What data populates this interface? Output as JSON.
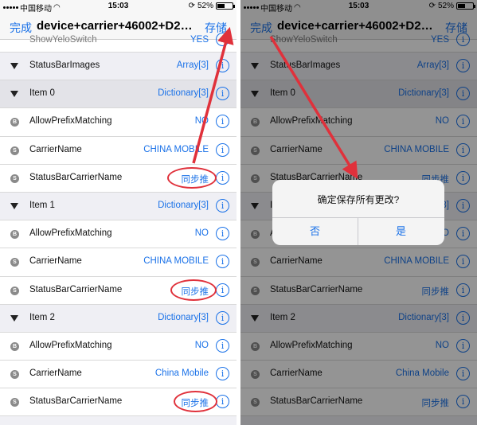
{
  "status_bar": {
    "carrier": "中国移动",
    "time": "15:03",
    "battery_label": "52%",
    "battery_level": 0.52
  },
  "nav": {
    "left": "完成",
    "title": "device+carrier+46002+D20+...",
    "right": "存储"
  },
  "rows": [
    {
      "kind": "partial",
      "key": "ShowYeloSwitch",
      "value": "YES"
    },
    {
      "kind": "group",
      "key": "StatusBarImages",
      "value": "Array[3]"
    },
    {
      "kind": "group2",
      "key": "Item 0",
      "value": "Dictionary[3]"
    },
    {
      "kind": "item",
      "badge": "B",
      "key": "AllowPrefixMatching",
      "value": "NO"
    },
    {
      "kind": "item",
      "badge": "S",
      "key": "CarrierName",
      "value": "CHINA  MOBILE"
    },
    {
      "kind": "item",
      "badge": "S",
      "key": "StatusBarCarrierName",
      "value": "同步推"
    },
    {
      "kind": "group",
      "key": "Item 1",
      "value": "Dictionary[3]"
    },
    {
      "kind": "item",
      "badge": "B",
      "key": "AllowPrefixMatching",
      "value": "NO"
    },
    {
      "kind": "item",
      "badge": "S",
      "key": "CarrierName",
      "value": "CHINA MOBILE"
    },
    {
      "kind": "item",
      "badge": "S",
      "key": "StatusBarCarrierName",
      "value": "同步推"
    },
    {
      "kind": "group",
      "key": "Item 2",
      "value": "Dictionary[3]"
    },
    {
      "kind": "item",
      "badge": "B",
      "key": "AllowPrefixMatching",
      "value": "NO"
    },
    {
      "kind": "item",
      "badge": "S",
      "key": "CarrierName",
      "value": "China Mobile"
    },
    {
      "kind": "item",
      "badge": "S",
      "key": "StatusBarCarrierName",
      "value": "同步推"
    }
  ],
  "alert": {
    "message": "确定保存所有更改?",
    "cancel": "否",
    "confirm": "是"
  },
  "colors": {
    "accent": "#1b72e8",
    "annotation": "#e0313b",
    "dim": "rgba(0,0,0,0.42)"
  },
  "icons": {
    "info": "info-circle-icon",
    "disclosure": "triangle-down-icon",
    "wifi": "wifi-icon",
    "battery": "battery-icon"
  }
}
